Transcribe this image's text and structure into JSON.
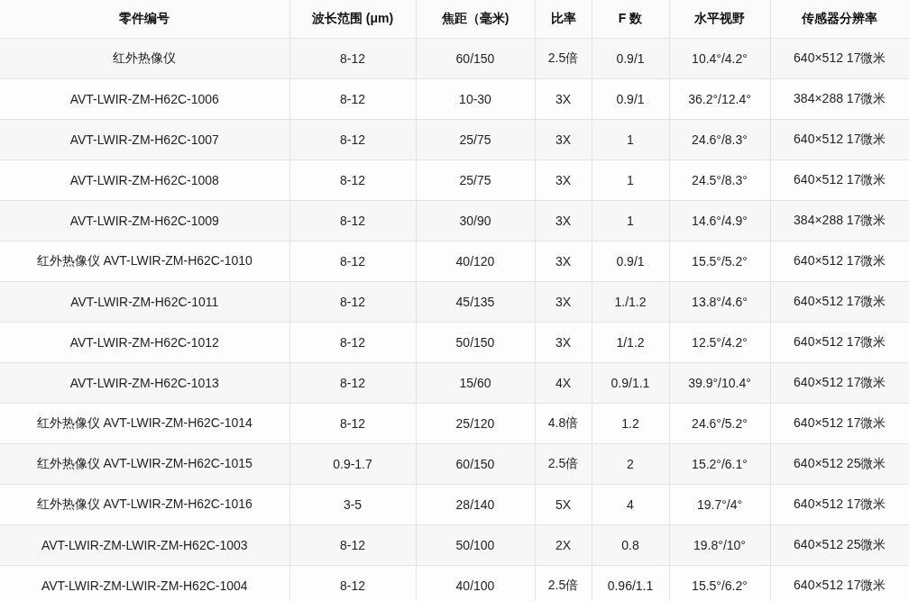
{
  "table": {
    "columns": [
      "零件编号",
      "波长范围 (μm)",
      "焦距（毫米)",
      "比率",
      "F 数",
      "水平视野",
      "传感器分辨率"
    ],
    "rows": [
      [
        "红外热像仪",
        "8-12",
        "60/150",
        "2.5倍",
        "0.9/1",
        "10.4°/4.2°",
        "640×512 17微米"
      ],
      [
        "AVT-LWIR-ZM-H62C-1006",
        "8-12",
        "10-30",
        "3X",
        "0.9/1",
        "36.2°/12.4°",
        "384×288 17微米"
      ],
      [
        "AVT-LWIR-ZM-H62C-1007",
        "8-12",
        "25/75",
        "3X",
        "1",
        "24.6°/8.3°",
        "640×512 17微米"
      ],
      [
        "AVT-LWIR-ZM-H62C-1008",
        "8-12",
        "25/75",
        "3X",
        "1",
        "24.5°/8.3°",
        "640×512 17微米"
      ],
      [
        "AVT-LWIR-ZM-H62C-1009",
        "8-12",
        "30/90",
        "3X",
        "1",
        "14.6°/4.9°",
        "384×288 17微米"
      ],
      [
        "红外热像仪 AVT-LWIR-ZM-H62C-1010",
        "8-12",
        "40/120",
        "3X",
        "0.9/1",
        "15.5°/5.2°",
        "640×512 17微米"
      ],
      [
        "AVT-LWIR-ZM-H62C-1011",
        "8-12",
        "45/135",
        "3X",
        "1./1.2",
        "13.8°/4.6°",
        "640×512 17微米"
      ],
      [
        "AVT-LWIR-ZM-H62C-1012",
        "8-12",
        "50/150",
        "3X",
        "1/1.2",
        "12.5°/4.2°",
        "640×512 17微米"
      ],
      [
        "AVT-LWIR-ZM-H62C-1013",
        "8-12",
        "15/60",
        "4X",
        "0.9/1.1",
        "39.9°/10.4°",
        "640×512 17微米"
      ],
      [
        "红外热像仪 AVT-LWIR-ZM-H62C-1014",
        "8-12",
        "25/120",
        "4.8倍",
        "1.2",
        "24.6°/5.2°",
        "640×512 17微米"
      ],
      [
        "红外热像仪 AVT-LWIR-ZM-H62C-1015",
        "0.9-1.7",
        "60/150",
        "2.5倍",
        "2",
        "15.2°/6.1°",
        "640×512 25微米"
      ],
      [
        "红外热像仪 AVT-LWIR-ZM-H62C-1016",
        "3-5",
        "28/140",
        "5X",
        "4",
        "19.7°/4°",
        "640×512 17微米"
      ],
      [
        "AVT-LWIR-ZM-LWIR-ZM-H62C-1003",
        "8-12",
        "50/100",
        "2X",
        "0.8",
        "19.8°/10°",
        "640×512 25微米"
      ],
      [
        "AVT-LWIR-ZM-LWIR-ZM-H62C-1004",
        "8-12",
        "40/100",
        "2.5倍",
        "0.96/1.1",
        "15.5°/6.2°",
        "640×512 17微米"
      ]
    ]
  }
}
